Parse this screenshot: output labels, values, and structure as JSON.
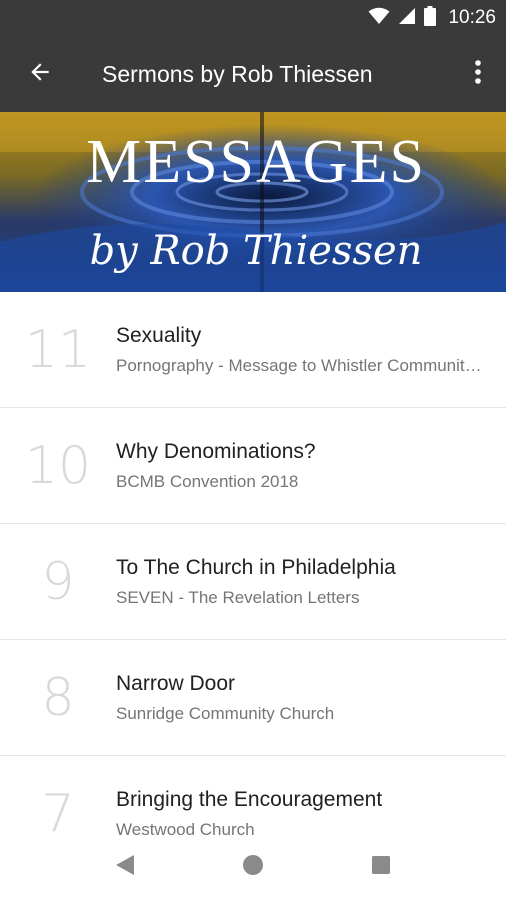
{
  "status": {
    "time": "10:26"
  },
  "app_bar": {
    "title": "Sermons by Rob Thiessen"
  },
  "banner": {
    "title": "MESSAGES",
    "subtitle": "by Rob Thiessen"
  },
  "sermons": [
    {
      "number": "11",
      "title": "Sexuality",
      "subtitle": "Pornography - Message to Whistler Community Church"
    },
    {
      "number": "10",
      "title": "Why Denominations?",
      "subtitle": "BCMB Convention 2018"
    },
    {
      "number": "9",
      "title": "To The Church in Philadelphia",
      "subtitle": "SEVEN - The Revelation Letters"
    },
    {
      "number": "8",
      "title": "Narrow Door",
      "subtitle": "Sunridge Community Church"
    },
    {
      "number": "7",
      "title": "Bringing the Encouragement",
      "subtitle": "Westwood Church"
    }
  ],
  "icons": {
    "wifi": "wifi-icon",
    "signal": "signal-icon",
    "battery": "battery-icon",
    "back": "back-arrow-icon",
    "more": "more-vert-icon",
    "nav_back": "nav-back-icon",
    "nav_home": "nav-home-icon",
    "nav_recents": "nav-recents-icon"
  },
  "colors": {
    "app_bar": "#3a3a3a",
    "number": "#d9d9d9",
    "title": "#212121",
    "subtitle": "#757575"
  }
}
